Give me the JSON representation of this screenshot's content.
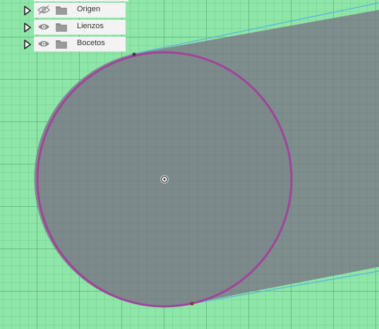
{
  "browser": {
    "items": [
      {
        "label": "Origen",
        "eye_icon": "eye-hidden-icon",
        "folder_icon": "folder-icon",
        "expand_icon": "expand-triangle-icon",
        "visible": false
      },
      {
        "label": "Lienzos",
        "eye_icon": "eye-icon",
        "folder_icon": "folder-icon",
        "expand_icon": "expand-triangle-icon",
        "visible": true
      },
      {
        "label": "Bocetos",
        "eye_icon": "eye-icon",
        "folder_icon": "folder-icon",
        "expand_icon": "expand-triangle-icon",
        "visible": true
      }
    ]
  },
  "canvas": {
    "background_color": "#8ee6a8",
    "shape_fill_color": "#7d8a8c",
    "circle_stroke_color": "#a0449a",
    "tangent_line_color": "#5fb6d9",
    "center_point_icon": "center-point-icon"
  }
}
